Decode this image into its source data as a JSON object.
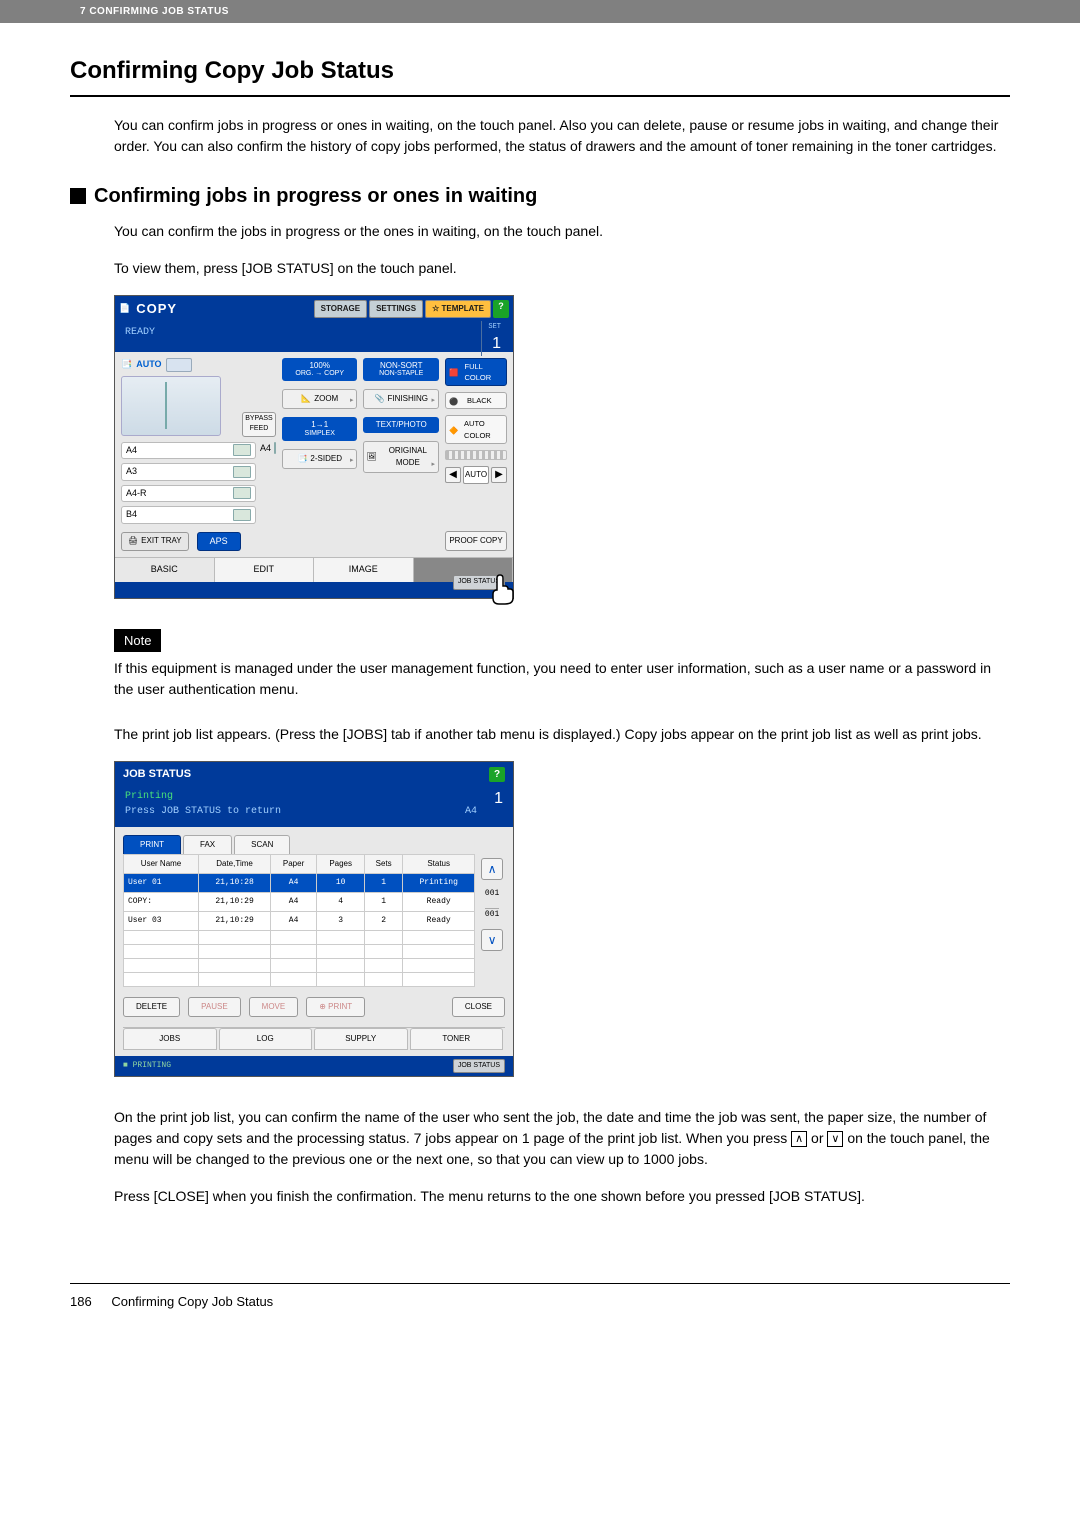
{
  "topbar": "7 CONFIRMING JOB STATUS",
  "h1": "Confirming Copy Job Status",
  "intro": "You can confirm jobs in progress or ones in waiting, on the touch panel. Also you can delete, pause or resume jobs in waiting, and change their order. You can also confirm the history of copy jobs performed, the status of drawers and the amount of toner remaining in the toner cartridges.",
  "h2": "Confirming jobs in progress or ones in waiting",
  "h2_p1": "You can confirm the jobs in progress or the ones in waiting, on the touch panel.",
  "h2_p2": "To view them, press [JOB STATUS] on the touch panel.",
  "note_label": "Note",
  "note_text": "If this equipment is managed under the user management function, you need to enter user information, such as a user name or a password in the user authentication menu.",
  "after_note": "The print job list appears. (Press the [JOBS] tab if another tab menu is displayed.) Copy jobs appear on the print job list as well as print jobs.",
  "after_fig2_a": "On the print job list, you can confirm the name of the user who sent the job, the date and time the job was sent, the paper size, the number of pages and copy sets and the processing status. 7 jobs appear on 1 page of the print job list. When you press ",
  "after_fig2_b": " or ",
  "after_fig2_c": " on the touch panel, the menu will be changed to the previous one or the next one, so that you can view up to 1000 jobs.",
  "after_fig2_close": "Press [CLOSE] when you finish the confirmation. The menu returns to the one shown before you pressed [JOB STATUS].",
  "footer_page": "186",
  "footer_title": "Confirming Copy Job Status",
  "fig1": {
    "title": "COPY",
    "tabs": {
      "storage": "STORAGE",
      "settings": "SETTINGS",
      "template": "TEMPLATE",
      "help": "?"
    },
    "ready": "READY",
    "set_label": "SET",
    "set_value": "1",
    "auto": "AUTO",
    "bypass": "BYPASS FEED",
    "trays": [
      "A4",
      "A3",
      "A4-R",
      "B4"
    ],
    "bigtray": "A4",
    "exit": "EXIT TRAY",
    "aps": "APS",
    "zoom_tile": {
      "top": "100%",
      "sub": "ORG. → COPY"
    },
    "zoom_btn": "ZOOM",
    "simplex_tile": {
      "top": "1→1",
      "sub": "SIMPLEX"
    },
    "twosided_btn": "2-SIDED",
    "nonsort_tile": {
      "top": "NON-SORT",
      "sub": "NON-STAPLE"
    },
    "finishing_btn": "FINISHING",
    "textphoto_tile": "TEXT/PHOTO",
    "origmode_btn": "ORIGINAL MODE",
    "colors": {
      "full": "FULL COLOR",
      "black": "BLACK",
      "auto": "AUTO COLOR"
    },
    "density_auto": "AUTO",
    "proof": "PROOF COPY",
    "bottom_tabs": {
      "basic": "BASIC",
      "edit": "EDIT",
      "image": "IMAGE"
    },
    "jobstatus": "JOB STATUS"
  },
  "fig2": {
    "title": "JOB STATUS",
    "help": "?",
    "sub1": "Printing",
    "sub2": "Press JOB STATUS to return",
    "sub_right": "A4",
    "sub_num": "1",
    "tabs": {
      "print": "PRINT",
      "fax": "FAX",
      "scan": "SCAN"
    },
    "cols": {
      "user": "User Name",
      "date": "Date,Time",
      "paper": "Paper",
      "pages": "Pages",
      "sets": "Sets",
      "status": "Status"
    },
    "rows": [
      {
        "user": "User 01",
        "date": "21,10:28",
        "paper": "A4",
        "pages": "10",
        "sets": "1",
        "status": "Printing",
        "selected": true
      },
      {
        "user": "COPY:",
        "date": "21,10:29",
        "paper": "A4",
        "pages": "4",
        "sets": "1",
        "status": "Ready",
        "selected": false
      },
      {
        "user": "User 03",
        "date": "21,10:29",
        "paper": "A4",
        "pages": "3",
        "sets": "2",
        "status": "Ready",
        "selected": false
      }
    ],
    "side": {
      "up": "∧",
      "page_cur": "001",
      "page_tot": "001",
      "down": "∨"
    },
    "actions": {
      "delete": "DELETE",
      "pause": "PAUSE",
      "move": "MOVE",
      "print": "PRINT",
      "close": "CLOSE"
    },
    "bottom_tabs": {
      "jobs": "JOBS",
      "log": "LOG",
      "supply": "SUPPLY",
      "toner": "TONER"
    },
    "footer_status": "■ PRINTING",
    "footer_btn": "JOB STATUS"
  }
}
